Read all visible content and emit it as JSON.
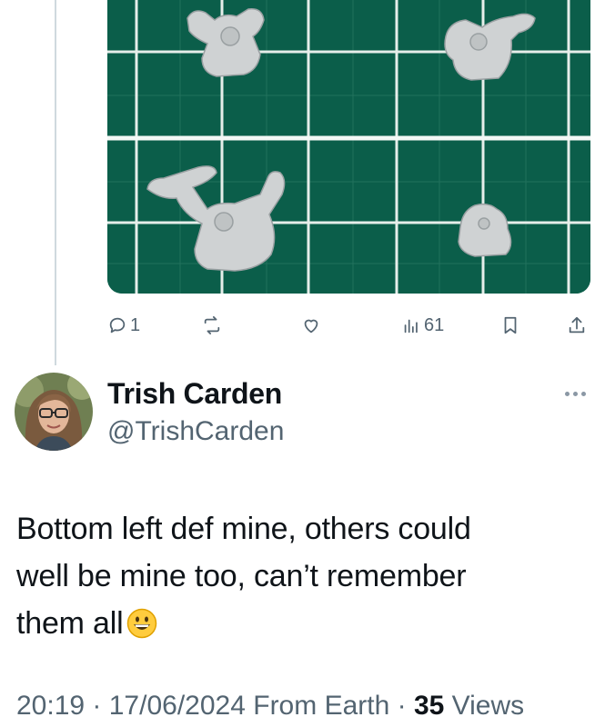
{
  "colors": {
    "mat_green": "#0b5e4a",
    "grid_line": "#e6eeea",
    "text_primary": "#0f1419",
    "text_secondary": "#536471",
    "thread_line": "#cfd9de"
  },
  "previous_post": {
    "media": {
      "icon": "photo-of-miniatures-on-cutting-mat"
    },
    "actions": {
      "reply_count": "1",
      "repost_count": "",
      "like_count": "",
      "views_count": "61"
    }
  },
  "post": {
    "author": {
      "name": "Trish Carden",
      "handle": "@TrishCarden",
      "avatar_icon": "profile-photo"
    },
    "text_line1": "Bottom left def mine, others could",
    "text_line2": "well be mine too, can’t remember",
    "text_line3": "them all",
    "emoji": "grinning-face-emoji",
    "time": "20:19",
    "sep1": " · ",
    "date": "17/06/2024",
    "source": " From Earth",
    "sep2": " · ",
    "views_number": "35",
    "views_label": " Views"
  }
}
